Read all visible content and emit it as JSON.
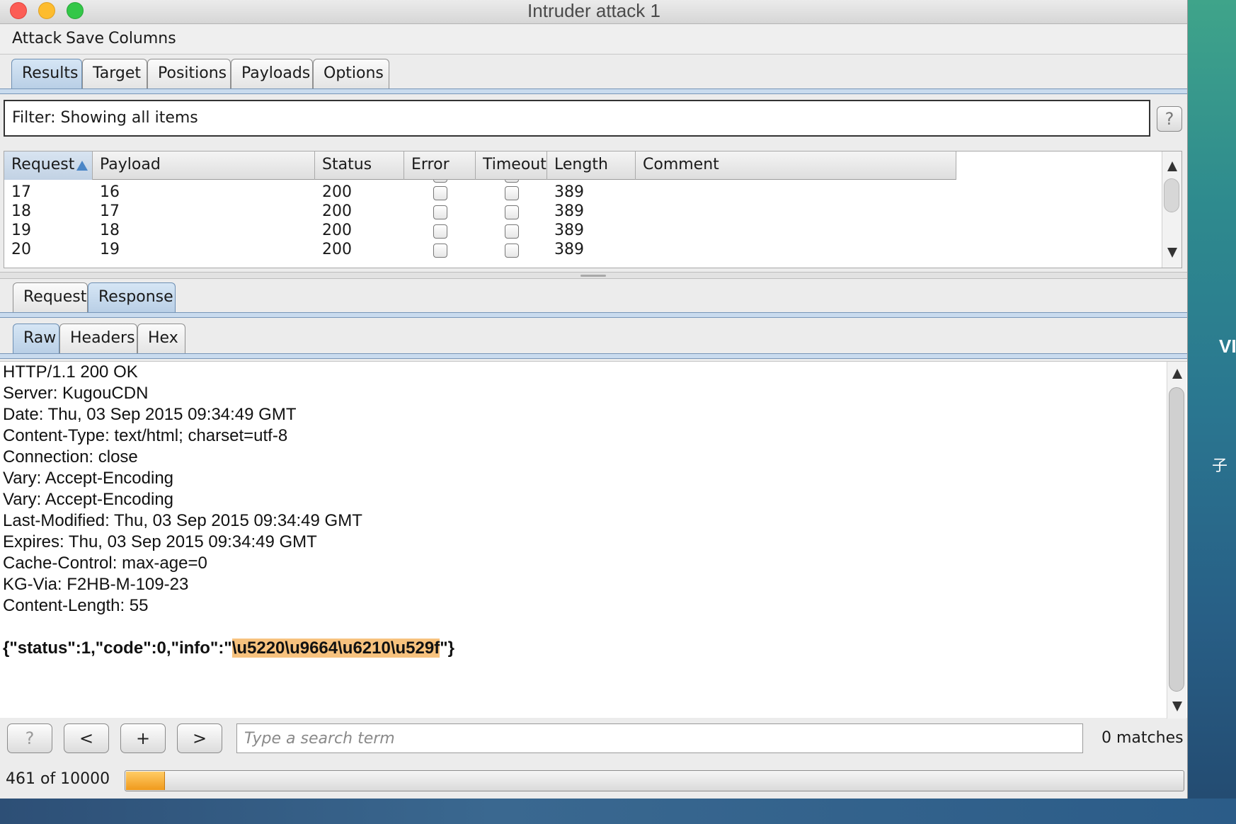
{
  "window": {
    "title": "Intruder attack 1"
  },
  "menu": [
    "Attack",
    "Save",
    "Columns"
  ],
  "main_tabs": [
    {
      "label": "Results",
      "active": true
    },
    {
      "label": "Target",
      "active": false
    },
    {
      "label": "Positions",
      "active": false
    },
    {
      "label": "Payloads",
      "active": false
    },
    {
      "label": "Options",
      "active": false
    }
  ],
  "filter": {
    "label": "Filter:",
    "text": "Showing all items",
    "help": "?"
  },
  "results_table": {
    "columns": [
      "Request",
      "Payload",
      "Status",
      "Error",
      "Timeout",
      "Length",
      "Comment"
    ],
    "sorted_column": "Request",
    "rows": [
      {
        "request": "17",
        "payload": "16",
        "status": "200",
        "error": false,
        "timeout": false,
        "length": "389",
        "comment": ""
      },
      {
        "request": "18",
        "payload": "17",
        "status": "200",
        "error": false,
        "timeout": false,
        "length": "389",
        "comment": ""
      },
      {
        "request": "19",
        "payload": "18",
        "status": "200",
        "error": false,
        "timeout": false,
        "length": "389",
        "comment": ""
      },
      {
        "request": "20",
        "payload": "19",
        "status": "200",
        "error": false,
        "timeout": false,
        "length": "389",
        "comment": ""
      }
    ]
  },
  "detail_tabs": [
    {
      "label": "Request",
      "active": false
    },
    {
      "label": "Response",
      "active": true
    }
  ],
  "view_tabs": [
    {
      "label": "Raw",
      "active": true
    },
    {
      "label": "Headers",
      "active": false
    },
    {
      "label": "Hex",
      "active": false
    }
  ],
  "response": {
    "header_lines": [
      "HTTP/1.1 200 OK",
      "Server: KugouCDN",
      "Date: Thu, 03 Sep 2015 09:34:49 GMT",
      "Content-Type: text/html; charset=utf-8",
      "Connection: close",
      "Vary: Accept-Encoding",
      "Vary: Accept-Encoding",
      "Last-Modified: Thu, 03 Sep 2015 09:34:49 GMT",
      "Expires: Thu, 03 Sep 2015 09:34:49 GMT",
      "Cache-Control: max-age=0",
      "KG-Via: F2HB-M-109-23",
      "Content-Length: 55"
    ],
    "body_prefix": "{\"status\":1,\"code\":0,\"info\":\"",
    "body_highlight": "\\u5220\\u9664\\u6210\\u529f",
    "body_suffix": "\"}"
  },
  "search": {
    "help_label": "?",
    "prev_label": "<",
    "add_label": "+",
    "next_label": ">",
    "placeholder": "Type a search term",
    "matches": "0 matches"
  },
  "progress": {
    "text": "461 of 10000",
    "fraction": 0.0461
  },
  "colors": {
    "highlight": "#f7c27e",
    "progress": "#f09a1c",
    "active_tab": "#b9cfe6"
  }
}
